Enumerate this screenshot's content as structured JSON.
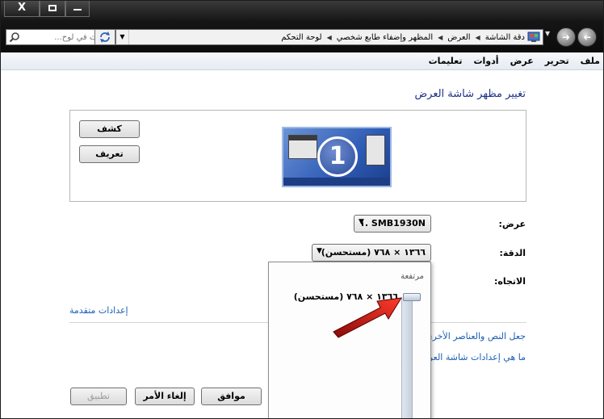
{
  "window": {
    "caption_buttons": {
      "close": "X",
      "maximize": "",
      "minimize": ""
    }
  },
  "search": {
    "placeholder": "البحث في لوح..."
  },
  "address": {
    "crumbs": [
      "لوحة التحكم",
      "المظهر وإضفاء طابع شخصي",
      "العرض",
      "دقة الشاشة"
    ]
  },
  "menu": [
    "ملف",
    "تحرير",
    "عرض",
    "أدوات",
    "تعليمات"
  ],
  "page": {
    "title": "تغيير مظهر شاشة العرض",
    "detect_button": "كشف",
    "identify_button": "تعريف",
    "monitor_number": "1",
    "display_label": "عرض:",
    "display_value": "SMB1930N .١",
    "resolution_label": "الدقة:",
    "resolution_value": "١٣٦٦ × ٧٦٨ (مستحسن)",
    "orientation_label": "الاتجاه:",
    "advanced_link": "إعدادات متقدمة",
    "text_size_link": "جعل النص والعناصر الأخرى",
    "which_settings_link": "ما هي إعدادات شاشة العرض",
    "ok_button": "موافق",
    "cancel_button": "إلغاء الأمر",
    "apply_button": "تطبيق"
  },
  "popup": {
    "high_label": "مرتفعة",
    "value": "١٣٦٦ × ٧٦٨ (مستحسن)",
    "slider_level": 1.0
  },
  "colors": {
    "accent": "#1a5fb4",
    "title": "#1e3287",
    "annotation_arrow": "#cc1010"
  }
}
